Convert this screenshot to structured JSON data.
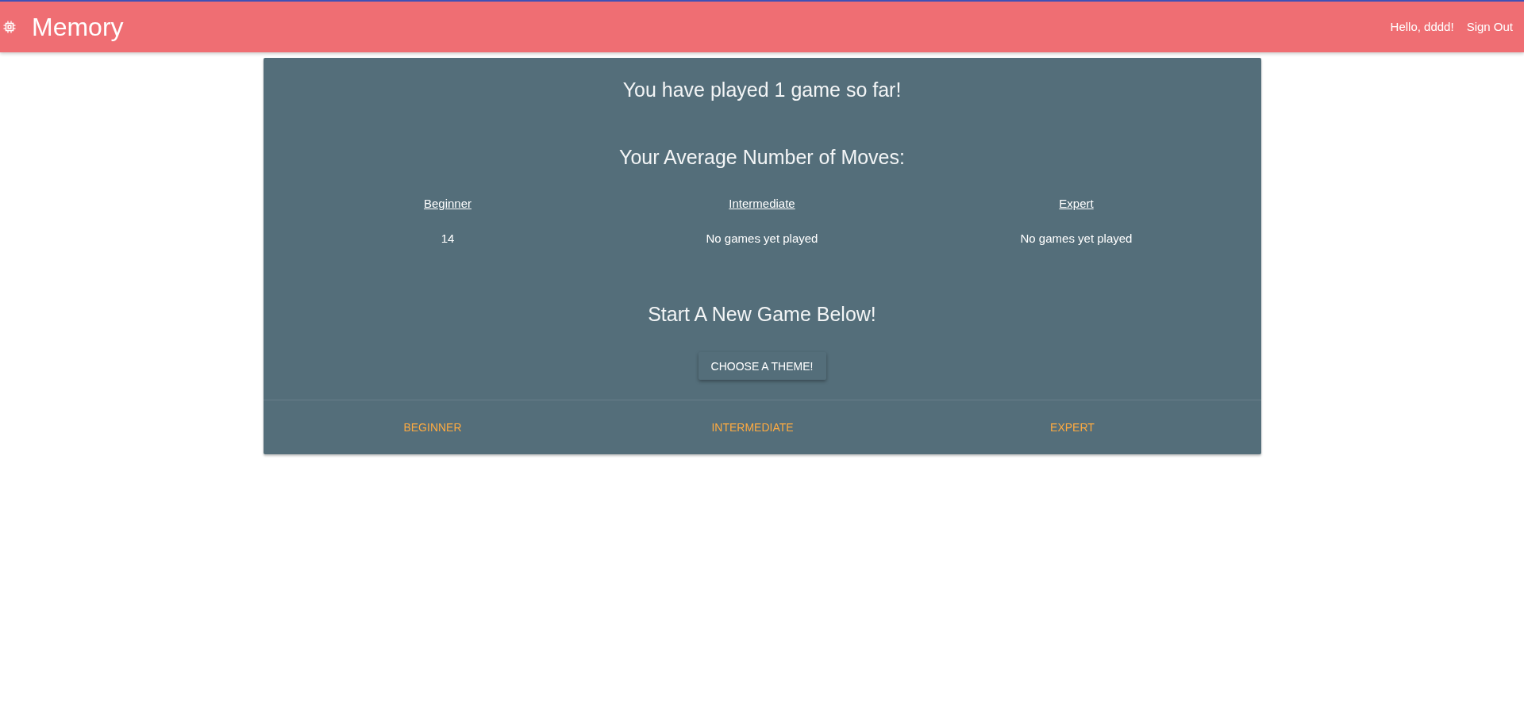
{
  "header": {
    "title": "Memory",
    "greeting": "Hello, dddd!",
    "sign_out": "Sign Out"
  },
  "card": {
    "games_played": "You have played 1 game so far!",
    "averages_heading": "Your Average Number of Moves:",
    "table": {
      "columns": [
        "Beginner",
        "Intermediate",
        "Expert"
      ],
      "rows": [
        [
          "14",
          "No games yet played",
          "No games yet played"
        ]
      ]
    },
    "new_game_heading": "Start A New Game Below!",
    "theme_button": "CHOOSE A THEME!",
    "actions": [
      "BEGINNER",
      "INTERMEDIATE",
      "EXPERT"
    ]
  }
}
